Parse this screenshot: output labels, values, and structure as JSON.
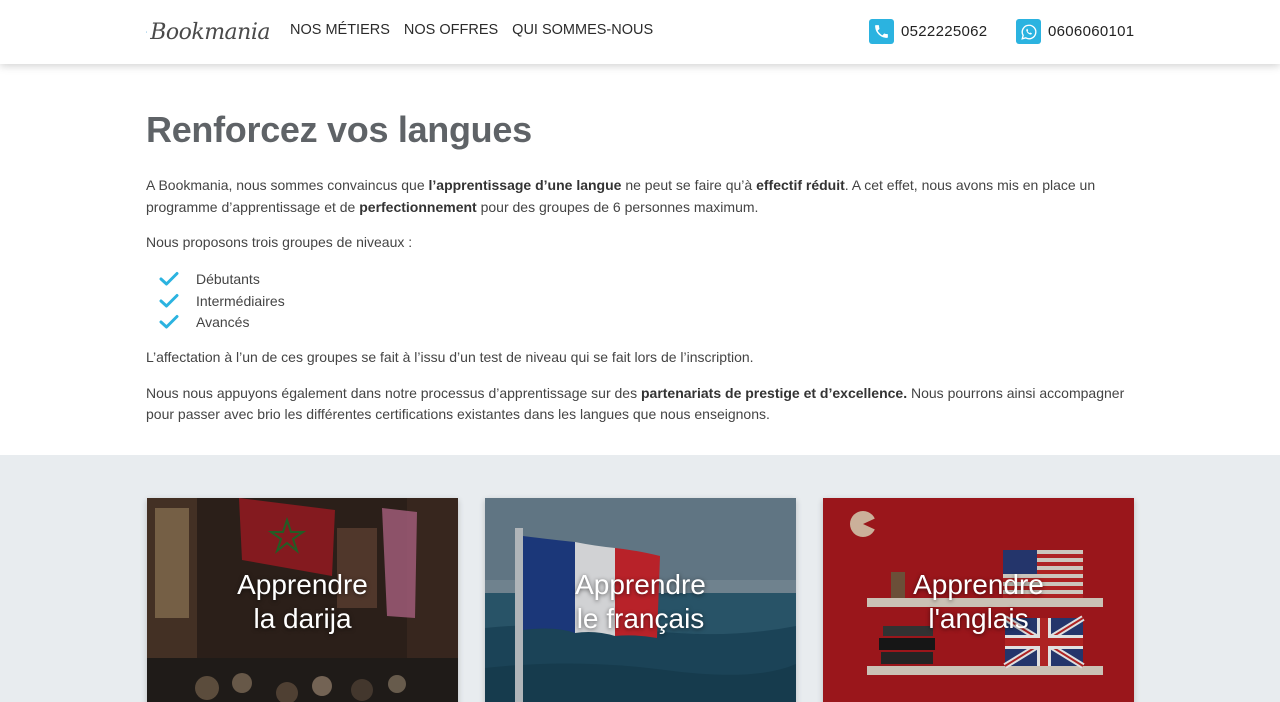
{
  "header": {
    "logo_text": "Bookmania",
    "nav": [
      {
        "label": "NOS MÉTIERS"
      },
      {
        "label": "NOS OFFRES"
      },
      {
        "label": "QUI SOMMES-NOUS"
      }
    ],
    "phone": {
      "icon": "phone-icon",
      "number": "0522225062"
    },
    "whatsapp": {
      "icon": "whatsapp-icon",
      "number": "0606060101"
    },
    "accent_color": "#2bb3e0"
  },
  "main": {
    "title": "Renforcez vos langues",
    "p1": {
      "t1": "A Bookmania, nous sommes convaincus que ",
      "b1": "l’apprentissage d’une langue",
      "t2": " ne peut se faire qu’à ",
      "b2": "effectif réduit",
      "t3": ". A cet effet, nous avons mis en place un programme d’apprentissage et de ",
      "b3": "perfectionnement",
      "t4": " pour des groupes de 6 personnes maximum."
    },
    "p2": "Nous proposons trois groupes de niveaux :",
    "levels": [
      "Débutants",
      "Intermédiaires",
      "Avancés"
    ],
    "p3": "L’affectation à l’un de ces groupes se fait à l’issu d’un test de niveau qui se fait lors de l’inscription.",
    "p4": {
      "t1": "Nous nous appuyons également dans notre processus d’apprentissage sur des ",
      "b1": "partenariats de prestige et d’excellence.",
      "t2": " Nous pourrons ainsi accompagner pour passer avec brio les différentes certifications existantes dans les langues que nous enseignons."
    }
  },
  "cards": [
    {
      "line1": "Apprendre",
      "line2": "la darija"
    },
    {
      "line1": "Apprendre",
      "line2": "le français"
    },
    {
      "line1": "Apprendre",
      "line2": "l'anglais"
    }
  ]
}
